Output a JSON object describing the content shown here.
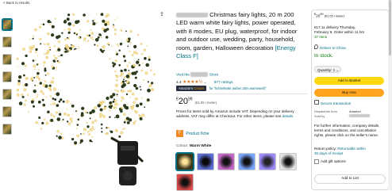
{
  "nav": {
    "back_label": "< Back to results"
  },
  "product": {
    "title": "Christmas fairy lights, 20 m 200 LED warm white fairy lights, power operated, with 8 modes, EU plug, waterproof, for indoor and outdoor use, wedding, party, household, room, garden, Halloween decoration",
    "energy_label": "[Energy Class F]",
    "visit_prefix": "Visit the",
    "visit_suffix": "Store",
    "rating_value": "4.4",
    "stars": "★★★★½",
    "ratings_count": "977 ratings",
    "choice_badge_a": "Amazon's ",
    "choice_badge_b": "Choice",
    "choice_for": "for \"lichterkette außen 20m warmweiß\"",
    "price_symbol": "€",
    "price_whole": "20",
    "price_fraction": "99",
    "price_unit": "(€1.05 / meter)",
    "vat_note": "Prices for items sold by Amazon include VAT. Depending on your delivery address, VAT may differ at Checkout. For other items, please see",
    "vat_link": "details.",
    "product_fiche": "Product fiche",
    "colour_label": "Colour:",
    "colour_value": "Warm White"
  },
  "buybox": {
    "price_symbol": "€",
    "price_whole": "20",
    "price_fraction": "99",
    "price_unit": "(€1.05 / meter)",
    "delivery_line1": "€17.11 delivery Thursday,",
    "delivery_line2": "February 9. Order within 11 hrs",
    "delivery_line3": "37 mins",
    "deliver_to": "Deliver to China",
    "stock": "In stock.",
    "quantity_label": "Quantity: 1",
    "add_basket": "Add to Basket",
    "buy_now": "Buy now",
    "secure": "Secure transaction",
    "dispatches_label": "Dispatches from",
    "dispatches_value": "Amazon",
    "sold_label": "Sold by",
    "info_text": "For further information, company details, terms and conditions, and cancellation rights, please click on the seller's name.",
    "return_label": "Return policy:",
    "return_link": "Returnable within",
    "return_link2": "30 days of receipt",
    "gift": "Add gift options",
    "add_list": "Add to List"
  }
}
